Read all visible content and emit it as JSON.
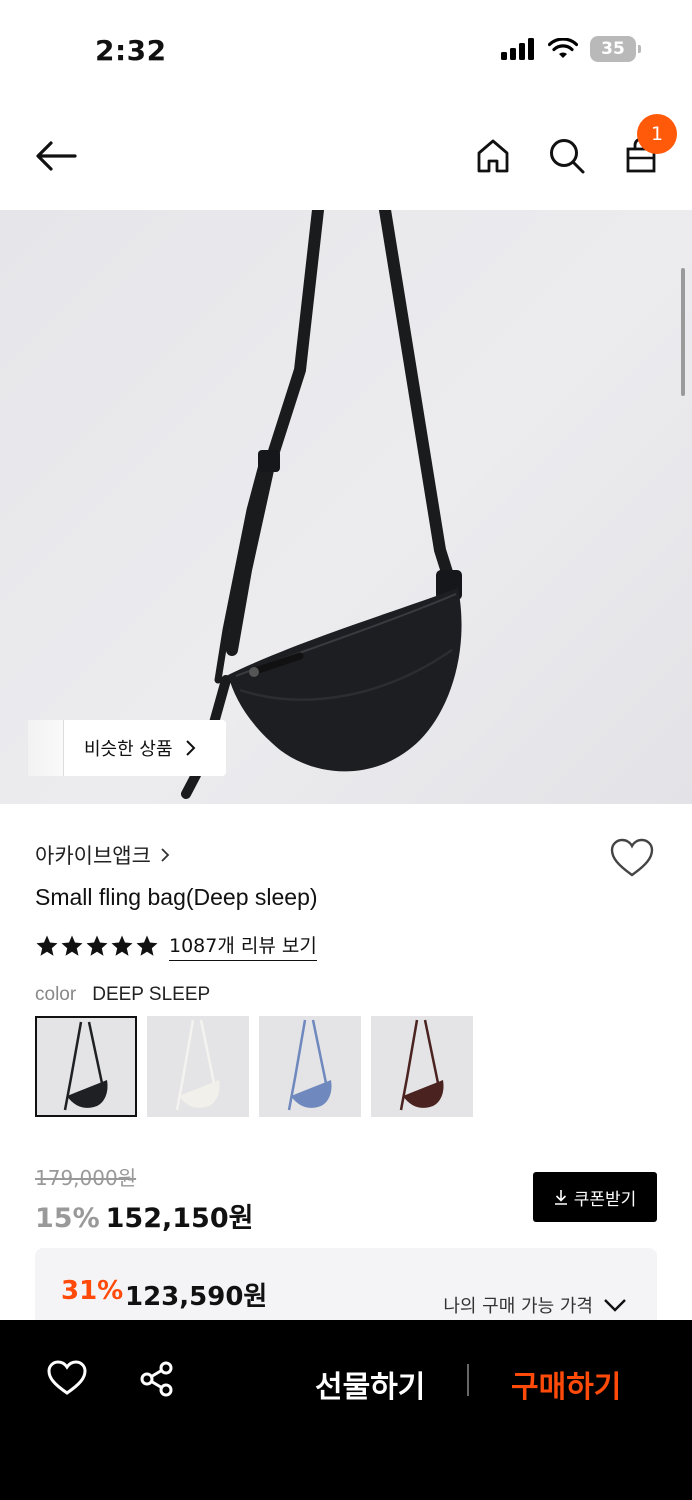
{
  "status_bar": {
    "time": "2:32",
    "battery": "35"
  },
  "nav": {
    "cart_count": "1"
  },
  "hero": {
    "similar_label": "비슷한 상품"
  },
  "product": {
    "brand": "아카이브앱크",
    "name": "Small fling bag(Deep sleep)",
    "rating_stars": 5,
    "review_link": "1087개 리뷰 보기",
    "color_label": "color",
    "color_value": "DEEP SLEEP",
    "swatches": [
      {
        "name": "deep-sleep",
        "color": "#1f2023",
        "selected": true
      },
      {
        "name": "ivory",
        "color": "#ecebe6",
        "selected": false
      },
      {
        "name": "blue",
        "color": "#6f88bd",
        "selected": false
      },
      {
        "name": "brown",
        "color": "#4a2320",
        "selected": false
      }
    ]
  },
  "pricing": {
    "original_price": "179,000원",
    "discount_rate": "15%",
    "sale_price": "152,150원",
    "coupon_label": "쿠폰받기",
    "my_discount_rate": "31%",
    "my_price": "123,590원",
    "my_price_toggle": "나의 구매 가능 가격"
  },
  "bottom_bar": {
    "gift_label": "선물하기",
    "buy_label": "구매하기"
  },
  "colors": {
    "accent": "#ff4a0a",
    "badge": "#ff5a0a"
  }
}
